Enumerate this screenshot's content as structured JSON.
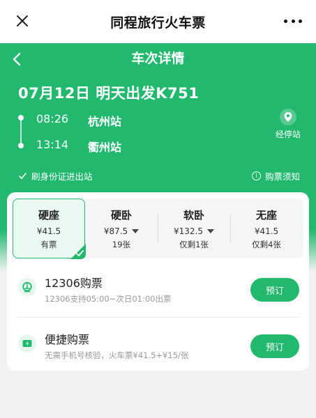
{
  "topbar": {
    "title": "同程旅行火车票"
  },
  "header": {
    "subtitle": "车次详情"
  },
  "trip": {
    "title": "07月12日 明天出发K751",
    "depart": {
      "time": "08:26",
      "station": "杭州站"
    },
    "arrive": {
      "time": "13:14",
      "station": "衢州站"
    },
    "via_label": "经停站"
  },
  "info": {
    "id_entry": "刷身份证进出站",
    "notice": "购票须知"
  },
  "seats": [
    {
      "name": "硬座",
      "price": "¥41.5",
      "avail": "有票",
      "dropdown": false,
      "selected": true
    },
    {
      "name": "硬卧",
      "price": "¥87.5",
      "avail": "19张",
      "dropdown": true,
      "selected": false
    },
    {
      "name": "软卧",
      "price": "¥132.5",
      "avail": "仅剩1张",
      "dropdown": true,
      "selected": false
    },
    {
      "name": "无座",
      "price": "¥41.5",
      "avail": "仅剩4张",
      "dropdown": false,
      "selected": false
    }
  ],
  "options": [
    {
      "title": "12306购票",
      "desc": "12306支持05:00~次日01:00出票",
      "button": "预订"
    },
    {
      "title": "便捷购票",
      "desc": "无需手机号核验，火车票¥41.5+¥15/张",
      "button": "预订"
    }
  ],
  "colors": {
    "brand": "#22b96e"
  }
}
